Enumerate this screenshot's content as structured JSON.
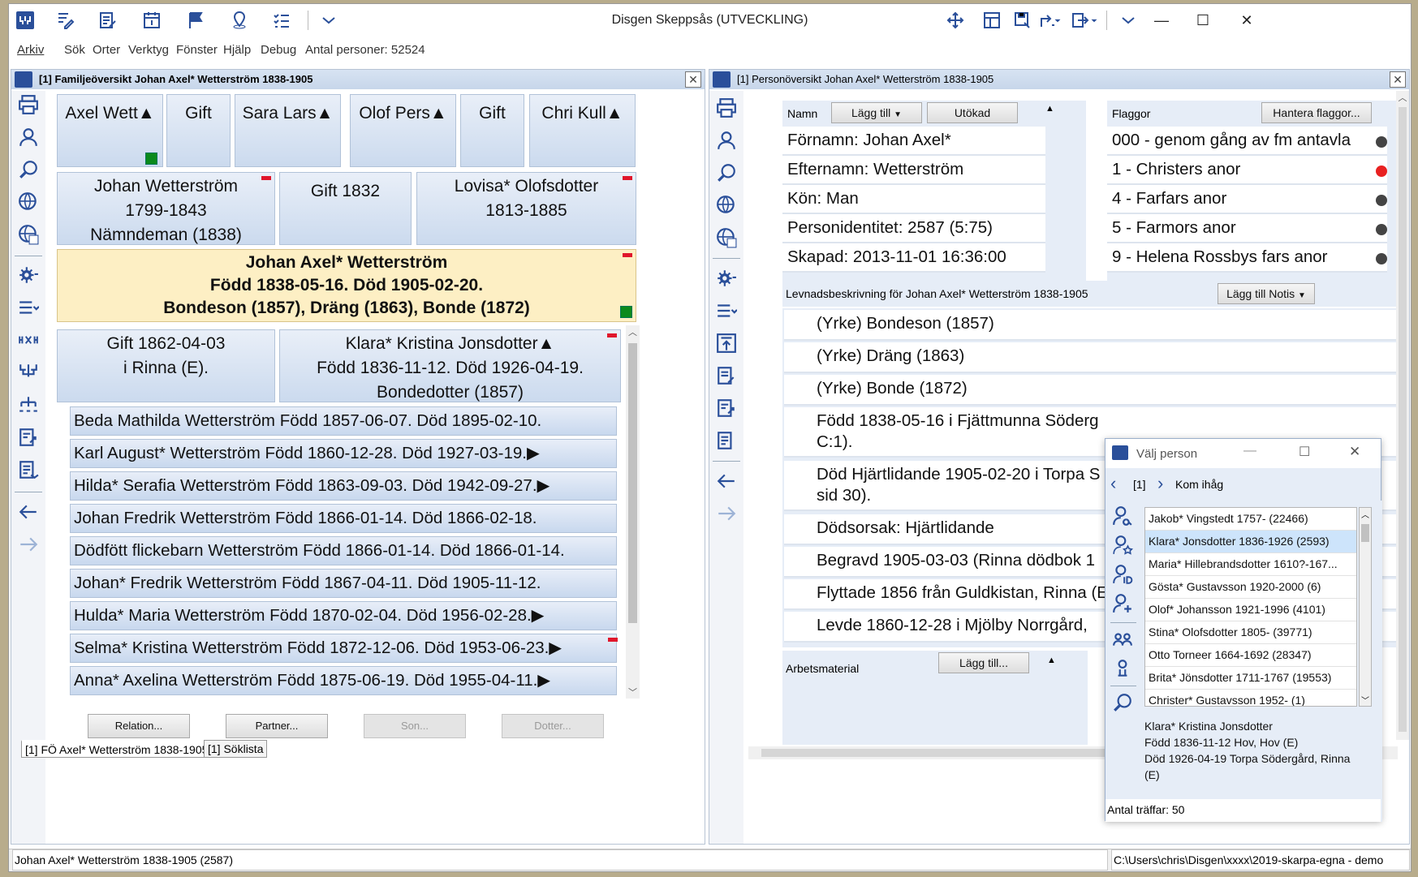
{
  "window": {
    "title": "Disgen Skeppsås (UTVECKLING)",
    "controls": {
      "minimize": "—",
      "maximize": "☐",
      "close": "✕"
    }
  },
  "menu": [
    "Arkiv",
    "Sök",
    "Orter",
    "Verktyg",
    "Fönster",
    "Hjälp",
    "Debug"
  ],
  "menu_count": "Antal personer: 52524",
  "family_panel": {
    "title": "[1] Familjeöversikt Johan Axel* Wetterström 1838-1905",
    "grandparents": [
      "Axel Wett▲",
      "Gift",
      "Sara Lars▲",
      "Olof Pers▲",
      "Gift",
      "Chri Kull▲"
    ],
    "father": {
      "name": "Johan Wetterström",
      "years": "1799-1843",
      "title": "Nämndeman (1838)"
    },
    "parents_marriage": "Gift 1832",
    "mother": {
      "name": "Lovisa* Olofsdotter",
      "years": "1813-1885"
    },
    "main": {
      "name": "Johan Axel* Wetterström",
      "dates": "Född 1838-05-16. Död 1905-02-20.",
      "occupations": "Bondeson (1857), Dräng (1863), Bonde (1872)"
    },
    "marriage": {
      "line1": "Gift 1862-04-03",
      "line2": "i Rinna (E)."
    },
    "spouse": {
      "name": "Klara* Kristina Jonsdotter▲",
      "dates": "Född 1836-11-12. Död 1926-04-19.",
      "occupation": "Bondedotter (1857)"
    },
    "children": [
      "Beda Mathilda Wetterström Född 1857-06-07. Död 1895-02-10.",
      "Karl August* Wetterström Född 1860-12-28. Död 1927-03-19.▶",
      "Hilda* Serafia Wetterström Född 1863-09-03. Död 1942-09-27.▶",
      "Johan Fredrik Wetterström Född 1866-01-14. Död 1866-02-18.",
      "Dödfött flickebarn Wetterström Född 1866-01-14. Död 1866-01-14.",
      "Johan* Fredrik Wetterström Född 1867-04-11. Död 1905-11-12.",
      "Hulda* Maria Wetterström Född 1870-02-04. Död 1956-02-28.▶",
      "Selma* Kristina Wetterström Född 1872-12-06. Död 1953-06-23.▶",
      "Anna* Axelina Wetterström Född 1875-06-19. Död 1955-04-11.▶"
    ],
    "buttons": {
      "relation": "Relation...",
      "partner": "Partner...",
      "son": "Son...",
      "dotter": "Dotter..."
    },
    "tabs": [
      "[1] FÖ Axel* Wetterström 1838-1905",
      "[1] Söklista"
    ]
  },
  "person_panel": {
    "title": "[1] Personöversikt Johan Axel* Wetterström 1838-1905",
    "name_header": "Namn",
    "add_button": "Lägg till",
    "extended_button": "Utökad",
    "fields": [
      "Förnamn: Johan Axel*",
      "Efternamn: Wetterström",
      "Kön: Man",
      "Personidentitet: 2587 (5:75)",
      "Skapad: 2013-11-01 16:36:00"
    ],
    "flags_header": "Flaggor",
    "flags_button": "Hantera flaggor...",
    "flags": [
      {
        "label": "000 - genom gång av  fm antavla",
        "color": "#444444"
      },
      {
        "label": "1 - Christers anor",
        "color": "#e82121"
      },
      {
        "label": "4 - Farfars anor",
        "color": "#444444"
      },
      {
        "label": "5 - Farmors anor",
        "color": "#444444"
      },
      {
        "label": "9 - Helena Rossbys fars anor",
        "color": "#444444"
      }
    ],
    "life_header": "Levnadsbeskrivning för Johan Axel* Wetterström 1838-1905",
    "add_note_button": "Lägg till Notis",
    "events": [
      "(Yrke) Bondeson (1857)",
      "(Yrke) Dräng (1863)",
      "(Yrke) Bonde (1872)",
      "Född 1838-05-16 i Fjättmunna Söderg",
      "C:1).",
      "Död Hjärtlidande 1905-02-20 i Torpa S",
      "sid 30).",
      "Dödsorsak: Hjärtlidande",
      "Begravd 1905-03-03 (Rinna dödbok 1",
      "Flyttade 1856 från Guldkistan, Rinna (E",
      "Levde 1860-12-28 i Mjölby Norrgård, "
    ],
    "work_header": "Arbetsmaterial",
    "work_button": "Lägg till..."
  },
  "popup": {
    "title": "Välj person",
    "nav_index": "[1]",
    "remember": "Kom ihåg",
    "list": [
      "Jakob* Vingstedt 1757- (22466)",
      "Klara* Jonsdotter 1836-1926 (2593)",
      "Maria* Hillebrandsdotter 1610?-167...",
      "Gösta* Gustavsson 1920-2000 (6)",
      "Olof* Johansson 1921-1996 (4101)",
      "Stina* Olofsdotter 1805- (39771)",
      "Otto Torneer 1664-1692 (28347)",
      "Brita* Jönsdotter 1711-1767 (19553)",
      "Christer* Gustavsson 1952- (1)"
    ],
    "selected_index": 1,
    "details": [
      "Klara* Kristina Jonsdotter",
      "Född 1836-11-12 Hov, Hov (E)",
      "Död 1926-04-19 Torpa Södergård, Rinna",
      "(E)"
    ],
    "hits": "Antal träffar: 50"
  },
  "status": {
    "left": "Johan Axel* Wetterström 1838-1905 (2587)",
    "right": "C:\\Users\\chris\\Disgen\\xxxx\\2019-skarpa-egna - demo"
  },
  "colors": {
    "accent": "#2a4f9a",
    "highlight": "#fdefc4",
    "cell": "#cbdaee",
    "red_marker": "#e0162b",
    "green_marker": "#0b8a1c"
  }
}
